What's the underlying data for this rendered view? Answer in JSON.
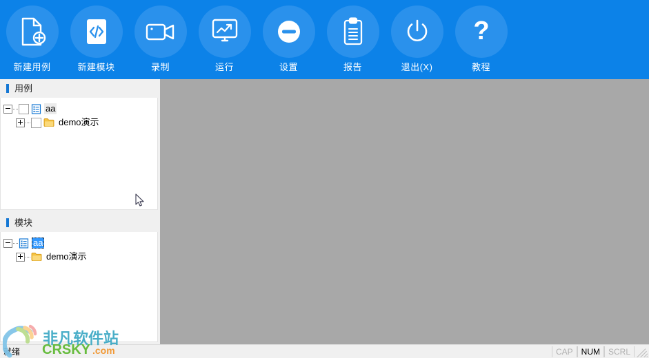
{
  "toolbar": {
    "background": "#0c82e8",
    "circle_color": "#2a91ec",
    "buttons": [
      {
        "label": "新建用例",
        "icon": "new-case-icon"
      },
      {
        "label": "新建模块",
        "icon": "code-module-icon"
      },
      {
        "label": "录制",
        "icon": "record-video-icon"
      },
      {
        "label": "运行",
        "icon": "monitor-run-icon"
      },
      {
        "label": "设置",
        "icon": "minus-circle-settings-icon"
      },
      {
        "label": "报告",
        "icon": "clipboard-report-icon"
      },
      {
        "label": "退出(X)",
        "icon": "power-exit-icon"
      },
      {
        "label": "教程",
        "icon": "question-help-icon"
      }
    ]
  },
  "panels": {
    "cases": {
      "title": "用例",
      "accent": "#1477d4",
      "rows": [
        {
          "expander": "minus",
          "has_checkbox": true,
          "checked": false,
          "icon": "list-document-icon",
          "label": "aa",
          "selected": "soft",
          "indent": false
        },
        {
          "expander": "plus",
          "has_checkbox": true,
          "checked": false,
          "icon": "folder-icon",
          "label": "demo演示",
          "selected": "none",
          "indent": true
        }
      ]
    },
    "modules": {
      "title": "模块",
      "accent": "#1477d4",
      "rows": [
        {
          "expander": "minus",
          "has_checkbox": false,
          "checked": false,
          "icon": "list-document-icon",
          "label": "aa",
          "selected": "blue",
          "indent": false
        },
        {
          "expander": "plus",
          "has_checkbox": false,
          "checked": false,
          "icon": "folder-icon",
          "label": "demo演示",
          "selected": "none",
          "indent": true
        }
      ]
    }
  },
  "workspace": {
    "background": "#a8a8a8"
  },
  "statusbar": {
    "message": "就绪",
    "indicators": [
      {
        "label": "CAP",
        "active": false
      },
      {
        "label": "NUM",
        "active": true
      },
      {
        "label": "SCRL",
        "active": false
      }
    ],
    "resize_grip": "resize-grip-icon"
  },
  "watermark": {
    "line1": "非凡软件站",
    "line2": "CRSKY",
    "line3": ".com",
    "logo": "swoosh-logo-icon"
  }
}
